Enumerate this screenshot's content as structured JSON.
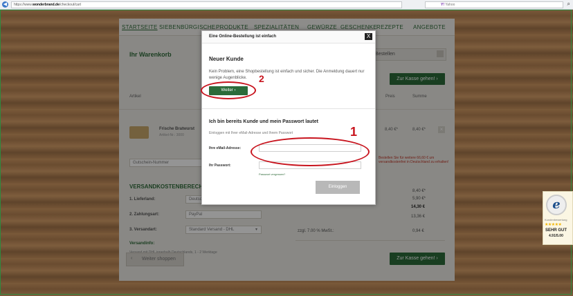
{
  "browser": {
    "url_prefix": "https://www.",
    "url_domain": "wonderbrand.de",
    "url_path": "/checkout/cart",
    "search_engine": "Yahoo",
    "search_brand": "Y!"
  },
  "nav": {
    "items": [
      "STARTSEITE",
      "SIEBENBÜRGISCHE",
      "PRODUKTE",
      "SPEZIALITÄTEN",
      "GEWÜRZE",
      "GESCHENKE",
      "REZEPTE",
      "ANGEBOTE"
    ]
  },
  "cart": {
    "title": "Ihr Warenkorb",
    "next_step": "Bestellen",
    "checkout_button": "Zur Kasse gehen!",
    "col_article": "Artikel",
    "col_price": "Preis",
    "col_sum": "Summe",
    "product_name": "Frische Bratwurst",
    "product_no": "Artikel-Nr.: 3000",
    "product_price": "8,40 €*",
    "product_sum": "8,40 €*",
    "voucher_placeholder": "Gutschein-Nummer",
    "shipping_note": "Bestellen Sie für weitere 66,60 € um versandkostenfrei in Deutschland zu erhalten!",
    "shipping_calc": "VERSANDKOSTENBERECHNUNG",
    "country_label": "1. Lieferland:",
    "country_value": "Deutschland",
    "payment_label": "2. Zahlungsart:",
    "payment_value": "PayPal",
    "shipping_label": "3. Versandart:",
    "shipping_value": "Standard Versand - DHL",
    "shipping_info_title": "Versandinfo:",
    "shipping_info_text": "Versand mit DHL innerhalb Deutschlands, 1 - 2 Werktage",
    "sum_lines": [
      "8,40 €*",
      "5,90 €*",
      "14,30 €",
      "13,36 €"
    ],
    "vat_label": "zzgl. 7.00 % MwSt.:",
    "vat_value": "0,94 €",
    "continue_button": "Weiter shoppen",
    "checkout_button_bottom": "Zur Kasse gehen!"
  },
  "modal": {
    "title": "Eine Online-Bestellung ist einfach",
    "close": "X",
    "new_customer_title": "Neuer Kunde",
    "new_customer_text": "Kein Problem, eine Shopbestellung ist einfach und sicher. Die Anmeldung dauert nur wenige Augenblicke.",
    "weiter_button": "Weiter",
    "login_title": "Ich bin bereits Kunde und mein Passwort lautet",
    "login_sub": "Einloggen mit Ihrer eMail-Adresse und Ihrem Passwort",
    "email_label": "Ihre eMail-Adresse:",
    "password_label": "Ihr Passwort:",
    "forgot": "Passwort vergessen?",
    "login_button": "Einloggen"
  },
  "annotations": {
    "one": "1",
    "two": "2"
  },
  "trust": {
    "seal_letter": "e",
    "caption": "Kundenbewertung",
    "stars": "★★★★★",
    "rating_text": "SEHR GUT",
    "score": "4.91/5.00"
  },
  "colors": {
    "brand_green": "#2b6b3a",
    "annotation_red": "#c8141e"
  }
}
